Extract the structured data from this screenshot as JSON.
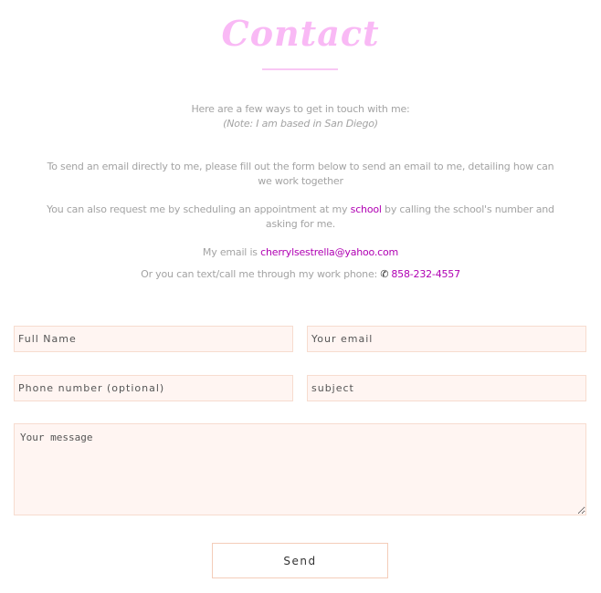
{
  "header": {
    "title": "Contact"
  },
  "intro": {
    "line1": "Here are a few ways to get in touch with me:",
    "note": "(Note: I am based in San Diego)"
  },
  "body": {
    "form_text": "To send an email directly to me, please fill out the form below to send an email to me, detailing how can we work together",
    "appointment_before": "You can also request me by scheduling an appointment at my ",
    "appointment_link": "school",
    "appointment_after": " by calling the school's number and asking for me.",
    "email_prefix": "My email is ",
    "email": "cherrylsestrella@yahoo.com",
    "phone_prefix": "Or you can text/call me through my work phone: ",
    "phone_icon": "phone-icon",
    "phone": "858-232-4557"
  },
  "form": {
    "full_name_placeholder": "Full Name",
    "email_placeholder": "Your email",
    "phone_placeholder": "Phone number (optional)",
    "subject_placeholder": "subject",
    "message_placeholder": "Your message",
    "send_label": "Send"
  },
  "colors": {
    "title": "#f9b9f5",
    "link": "#b000b3",
    "field_bg": "#fff5f2",
    "field_border": "#f7dccf"
  }
}
